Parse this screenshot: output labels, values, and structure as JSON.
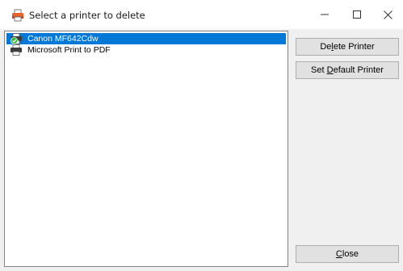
{
  "window": {
    "title": "Select a printer to delete",
    "caption_buttons": {
      "minimize": "—",
      "maximize": "☐",
      "close": "✕"
    }
  },
  "printers": [
    {
      "name": "Canon MF642Cdw",
      "selected": true,
      "is_default": true,
      "icon": "printer-default-icon"
    },
    {
      "name": "Microsoft Print to PDF",
      "selected": false,
      "is_default": false,
      "icon": "printer-icon"
    }
  ],
  "buttons": {
    "delete": {
      "before": "De",
      "mnemonic": "l",
      "after": "ete Printer"
    },
    "set_default": {
      "before": "Set ",
      "mnemonic": "D",
      "after": "efault Printer"
    },
    "close": {
      "before": "",
      "mnemonic": "C",
      "after": "lose"
    }
  },
  "colors": {
    "selection": "#0078d7",
    "default_check": "#2db52d"
  }
}
